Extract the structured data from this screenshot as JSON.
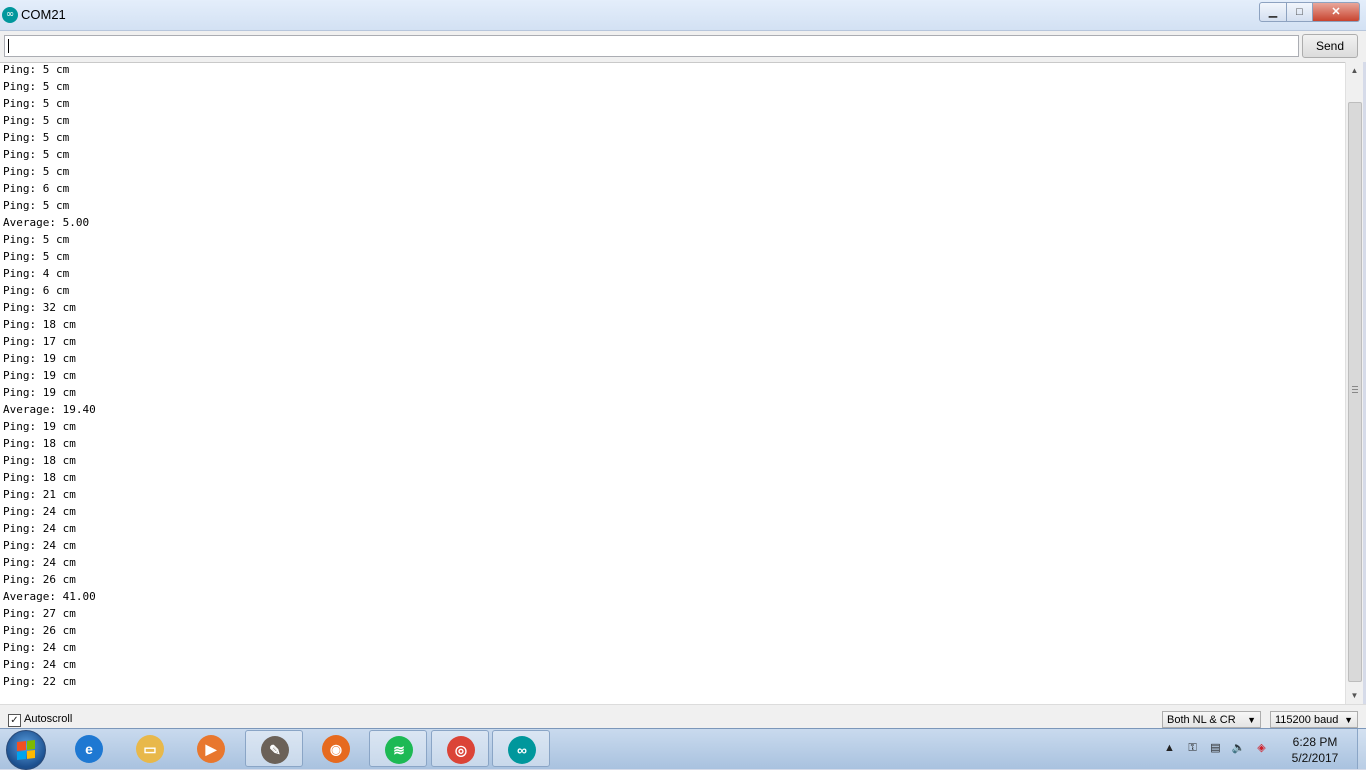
{
  "window": {
    "title": "COM21"
  },
  "send": {
    "input_value": "",
    "button_label": "Send"
  },
  "output": {
    "lines": [
      "Ping: 5 cm",
      "Ping: 5 cm",
      "Ping: 5 cm",
      "Ping: 5 cm",
      "Ping: 5 cm",
      "Ping: 5 cm",
      "Ping: 5 cm",
      "Ping: 6 cm",
      "Ping: 5 cm",
      "Average: 5.00",
      "Ping: 5 cm",
      "Ping: 5 cm",
      "Ping: 4 cm",
      "Ping: 6 cm",
      "Ping: 32 cm",
      "Ping: 18 cm",
      "Ping: 17 cm",
      "Ping: 19 cm",
      "Ping: 19 cm",
      "Ping: 19 cm",
      "Average: 19.40",
      "Ping: 19 cm",
      "Ping: 18 cm",
      "Ping: 18 cm",
      "Ping: 18 cm",
      "Ping: 21 cm",
      "Ping: 24 cm",
      "Ping: 24 cm",
      "Ping: 24 cm",
      "Ping: 24 cm",
      "Ping: 26 cm",
      "Average: 41.00",
      "Ping: 27 cm",
      "Ping: 26 cm",
      "Ping: 24 cm",
      "Ping: 24 cm",
      "Ping: 22 cm"
    ]
  },
  "bottom": {
    "autoscroll_label": "Autoscroll",
    "autoscroll_checked": true,
    "line_ending": "Both NL & CR",
    "baud_rate": "115200 baud"
  },
  "taskbar": {
    "apps": [
      {
        "name": "internet-explorer",
        "icon": "ie-icon",
        "color": "#1e78d2",
        "glyph": "e",
        "active": false
      },
      {
        "name": "file-explorer",
        "icon": "folder-icon",
        "color": "#e8b84a",
        "glyph": "▭",
        "active": false
      },
      {
        "name": "media-player",
        "icon": "media-player-icon",
        "color": "#e8772e",
        "glyph": "▶",
        "active": false
      },
      {
        "name": "gimp",
        "icon": "gimp-icon",
        "color": "#6b6158",
        "glyph": "✎",
        "active": true
      },
      {
        "name": "firefox",
        "icon": "firefox-icon",
        "color": "#e66a1f",
        "glyph": "◉",
        "active": false
      },
      {
        "name": "spotify",
        "icon": "spotify-icon",
        "color": "#1db954",
        "glyph": "≋",
        "active": true
      },
      {
        "name": "chrome",
        "icon": "chrome-icon",
        "color": "#db4437",
        "glyph": "◎",
        "active": true
      },
      {
        "name": "arduino",
        "icon": "arduino-icon",
        "color": "#00979c",
        "glyph": "∞",
        "active": true
      }
    ],
    "clock_time": "6:28 PM",
    "clock_date": "5/2/2017"
  }
}
